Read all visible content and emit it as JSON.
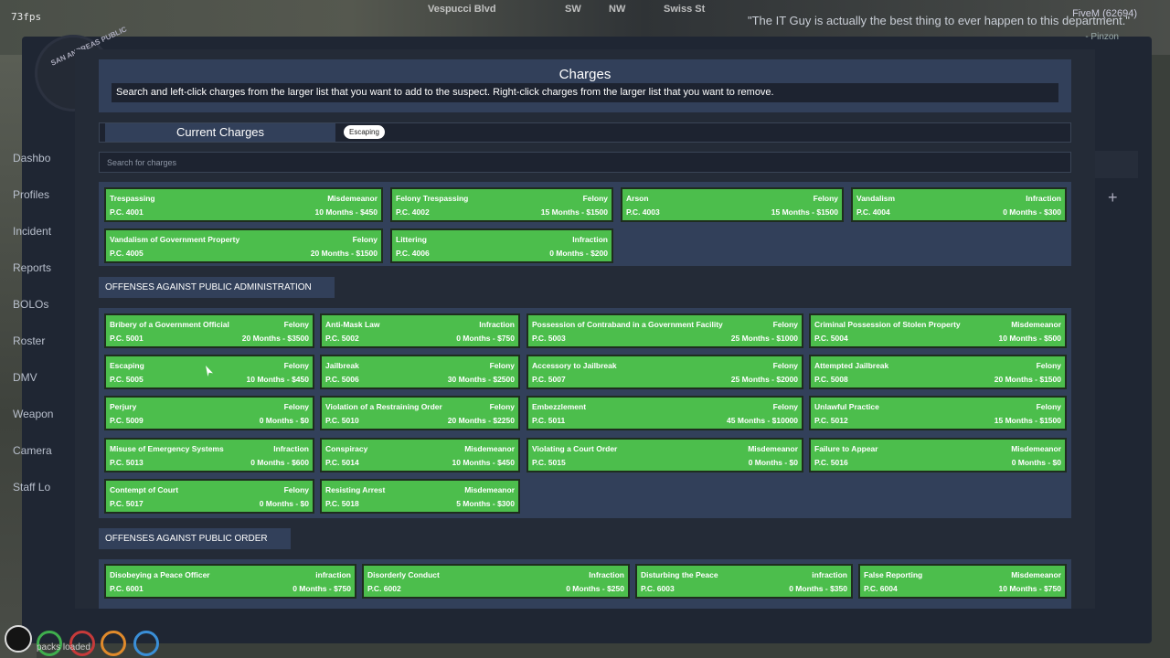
{
  "hud": {
    "fps": "73fps",
    "streets": [
      "Vespucci Blvd",
      "SW",
      "NW",
      "Swiss St"
    ],
    "top_right": "FiveM (62694)",
    "quote": "\"The IT Guy is actually the best thing to ever happen to this department.\"",
    "quote_author": "- Pinzon",
    "bottom_text": "packs loaded"
  },
  "mdt": {
    "logo_text": "SAN ANDREAS PUBLIC",
    "nav": [
      "Dashbo",
      "Profiles",
      "Incident",
      "Reports",
      "BOLOs",
      "Roster",
      "DMV",
      "Weapon",
      "Camera",
      "Staff Lo"
    ]
  },
  "modal": {
    "title": "Charges",
    "description": "Search and left-click charges from the larger list that you want to add to the suspect. Right-click charges from the larger list that you want to remove.",
    "current_label": "Current Charges",
    "current_charges": [
      "Escaping"
    ],
    "search_placeholder": "Search for charges"
  },
  "sections": [
    {
      "title": "",
      "rows": [
        [
          {
            "name": "Trespassing",
            "class": "Misdemeanor",
            "code": "P.C. 4001",
            "penalty": "10 Months - $450"
          },
          {
            "name": "Felony Trespassing",
            "class": "Felony",
            "code": "P.C. 4002",
            "penalty": "15 Months - $1500"
          },
          {
            "name": "Arson",
            "class": "Felony",
            "code": "P.C. 4003",
            "penalty": "15 Months - $1500"
          },
          {
            "name": "Vandalism",
            "class": "Infraction",
            "code": "P.C. 4004",
            "penalty": "0 Months - $300"
          }
        ],
        [
          {
            "name": "Vandalism of Government Property",
            "class": "Felony",
            "code": "P.C. 4005",
            "penalty": "20 Months - $1500"
          },
          {
            "name": "Littering",
            "class": "Infraction",
            "code": "P.C. 4006",
            "penalty": "0 Months - $200"
          }
        ]
      ]
    },
    {
      "title": "OFFENSES AGAINST PUBLIC ADMINISTRATION",
      "rows": [
        [
          {
            "name": "Bribery of a Government Official",
            "class": "Felony",
            "code": "P.C. 5001",
            "penalty": "20 Months - $3500"
          },
          {
            "name": "Anti-Mask Law",
            "class": "Infraction",
            "code": "P.C. 5002",
            "penalty": "0 Months - $750"
          },
          {
            "name": "Possession of Contraband in a Government Facility",
            "class": "Felony",
            "code": "P.C. 5003",
            "penalty": "25 Months - $1000"
          },
          {
            "name": "Criminal Possession of Stolen Property",
            "class": "Misdemeanor",
            "code": "P.C. 5004",
            "penalty": "10 Months - $500"
          }
        ],
        [
          {
            "name": "Escaping",
            "class": "Felony",
            "code": "P.C. 5005",
            "penalty": "10 Months - $450"
          },
          {
            "name": "Jailbreak",
            "class": "Felony",
            "code": "P.C. 5006",
            "penalty": "30 Months - $2500"
          },
          {
            "name": "Accessory to Jailbreak",
            "class": "Felony",
            "code": "P.C. 5007",
            "penalty": "25 Months - $2000"
          },
          {
            "name": "Attempted Jailbreak",
            "class": "Felony",
            "code": "P.C. 5008",
            "penalty": "20 Months - $1500"
          }
        ],
        [
          {
            "name": "Perjury",
            "class": "Felony",
            "code": "P.C. 5009",
            "penalty": "0 Months - $0"
          },
          {
            "name": "Violation of a Restraining Order",
            "class": "Felony",
            "code": "P.C. 5010",
            "penalty": "20 Months - $2250"
          },
          {
            "name": "Embezzlement",
            "class": "Felony",
            "code": "P.C. 5011",
            "penalty": "45 Months - $10000"
          },
          {
            "name": "Unlawful Practice",
            "class": "Felony",
            "code": "P.C. 5012",
            "penalty": "15 Months - $1500"
          }
        ],
        [
          {
            "name": "Misuse of Emergency Systems",
            "class": "Infraction",
            "code": "P.C. 5013",
            "penalty": "0 Months - $600"
          },
          {
            "name": "Conspiracy",
            "class": "Misdemeanor",
            "code": "P.C. 5014",
            "penalty": "10 Months - $450"
          },
          {
            "name": "Violating a Court Order",
            "class": "Misdemeanor",
            "code": "P.C. 5015",
            "penalty": "0 Months - $0"
          },
          {
            "name": "Failure to Appear",
            "class": "Misdemeanor",
            "code": "P.C. 5016",
            "penalty": "0 Months - $0"
          }
        ],
        [
          {
            "name": "Contempt of Court",
            "class": "Felony",
            "code": "P.C. 5017",
            "penalty": "0 Months - $0"
          },
          {
            "name": "Resisting Arrest",
            "class": "Misdemeanor",
            "code": "P.C. 5018",
            "penalty": "5 Months - $300"
          }
        ]
      ]
    },
    {
      "title": "OFFENSES AGAINST PUBLIC ORDER",
      "rows": [
        [
          {
            "name": "Disobeying a Peace Officer",
            "class": "infraction",
            "code": "P.C. 6001",
            "penalty": "0 Months - $750"
          },
          {
            "name": "Disorderly Conduct",
            "class": "Infraction",
            "code": "P.C. 6002",
            "penalty": "0 Months - $250"
          },
          {
            "name": "Disturbing the Peace",
            "class": "infraction",
            "code": "P.C. 6003",
            "penalty": "0 Months - $350"
          },
          {
            "name": "False Reporting",
            "class": "Misdemeanor",
            "code": "P.C. 6004",
            "penalty": "10 Months - $750"
          }
        ]
      ]
    }
  ],
  "colors": {
    "card": "#4cbe4c",
    "panel": "#32405a",
    "modal": "#242b37"
  }
}
